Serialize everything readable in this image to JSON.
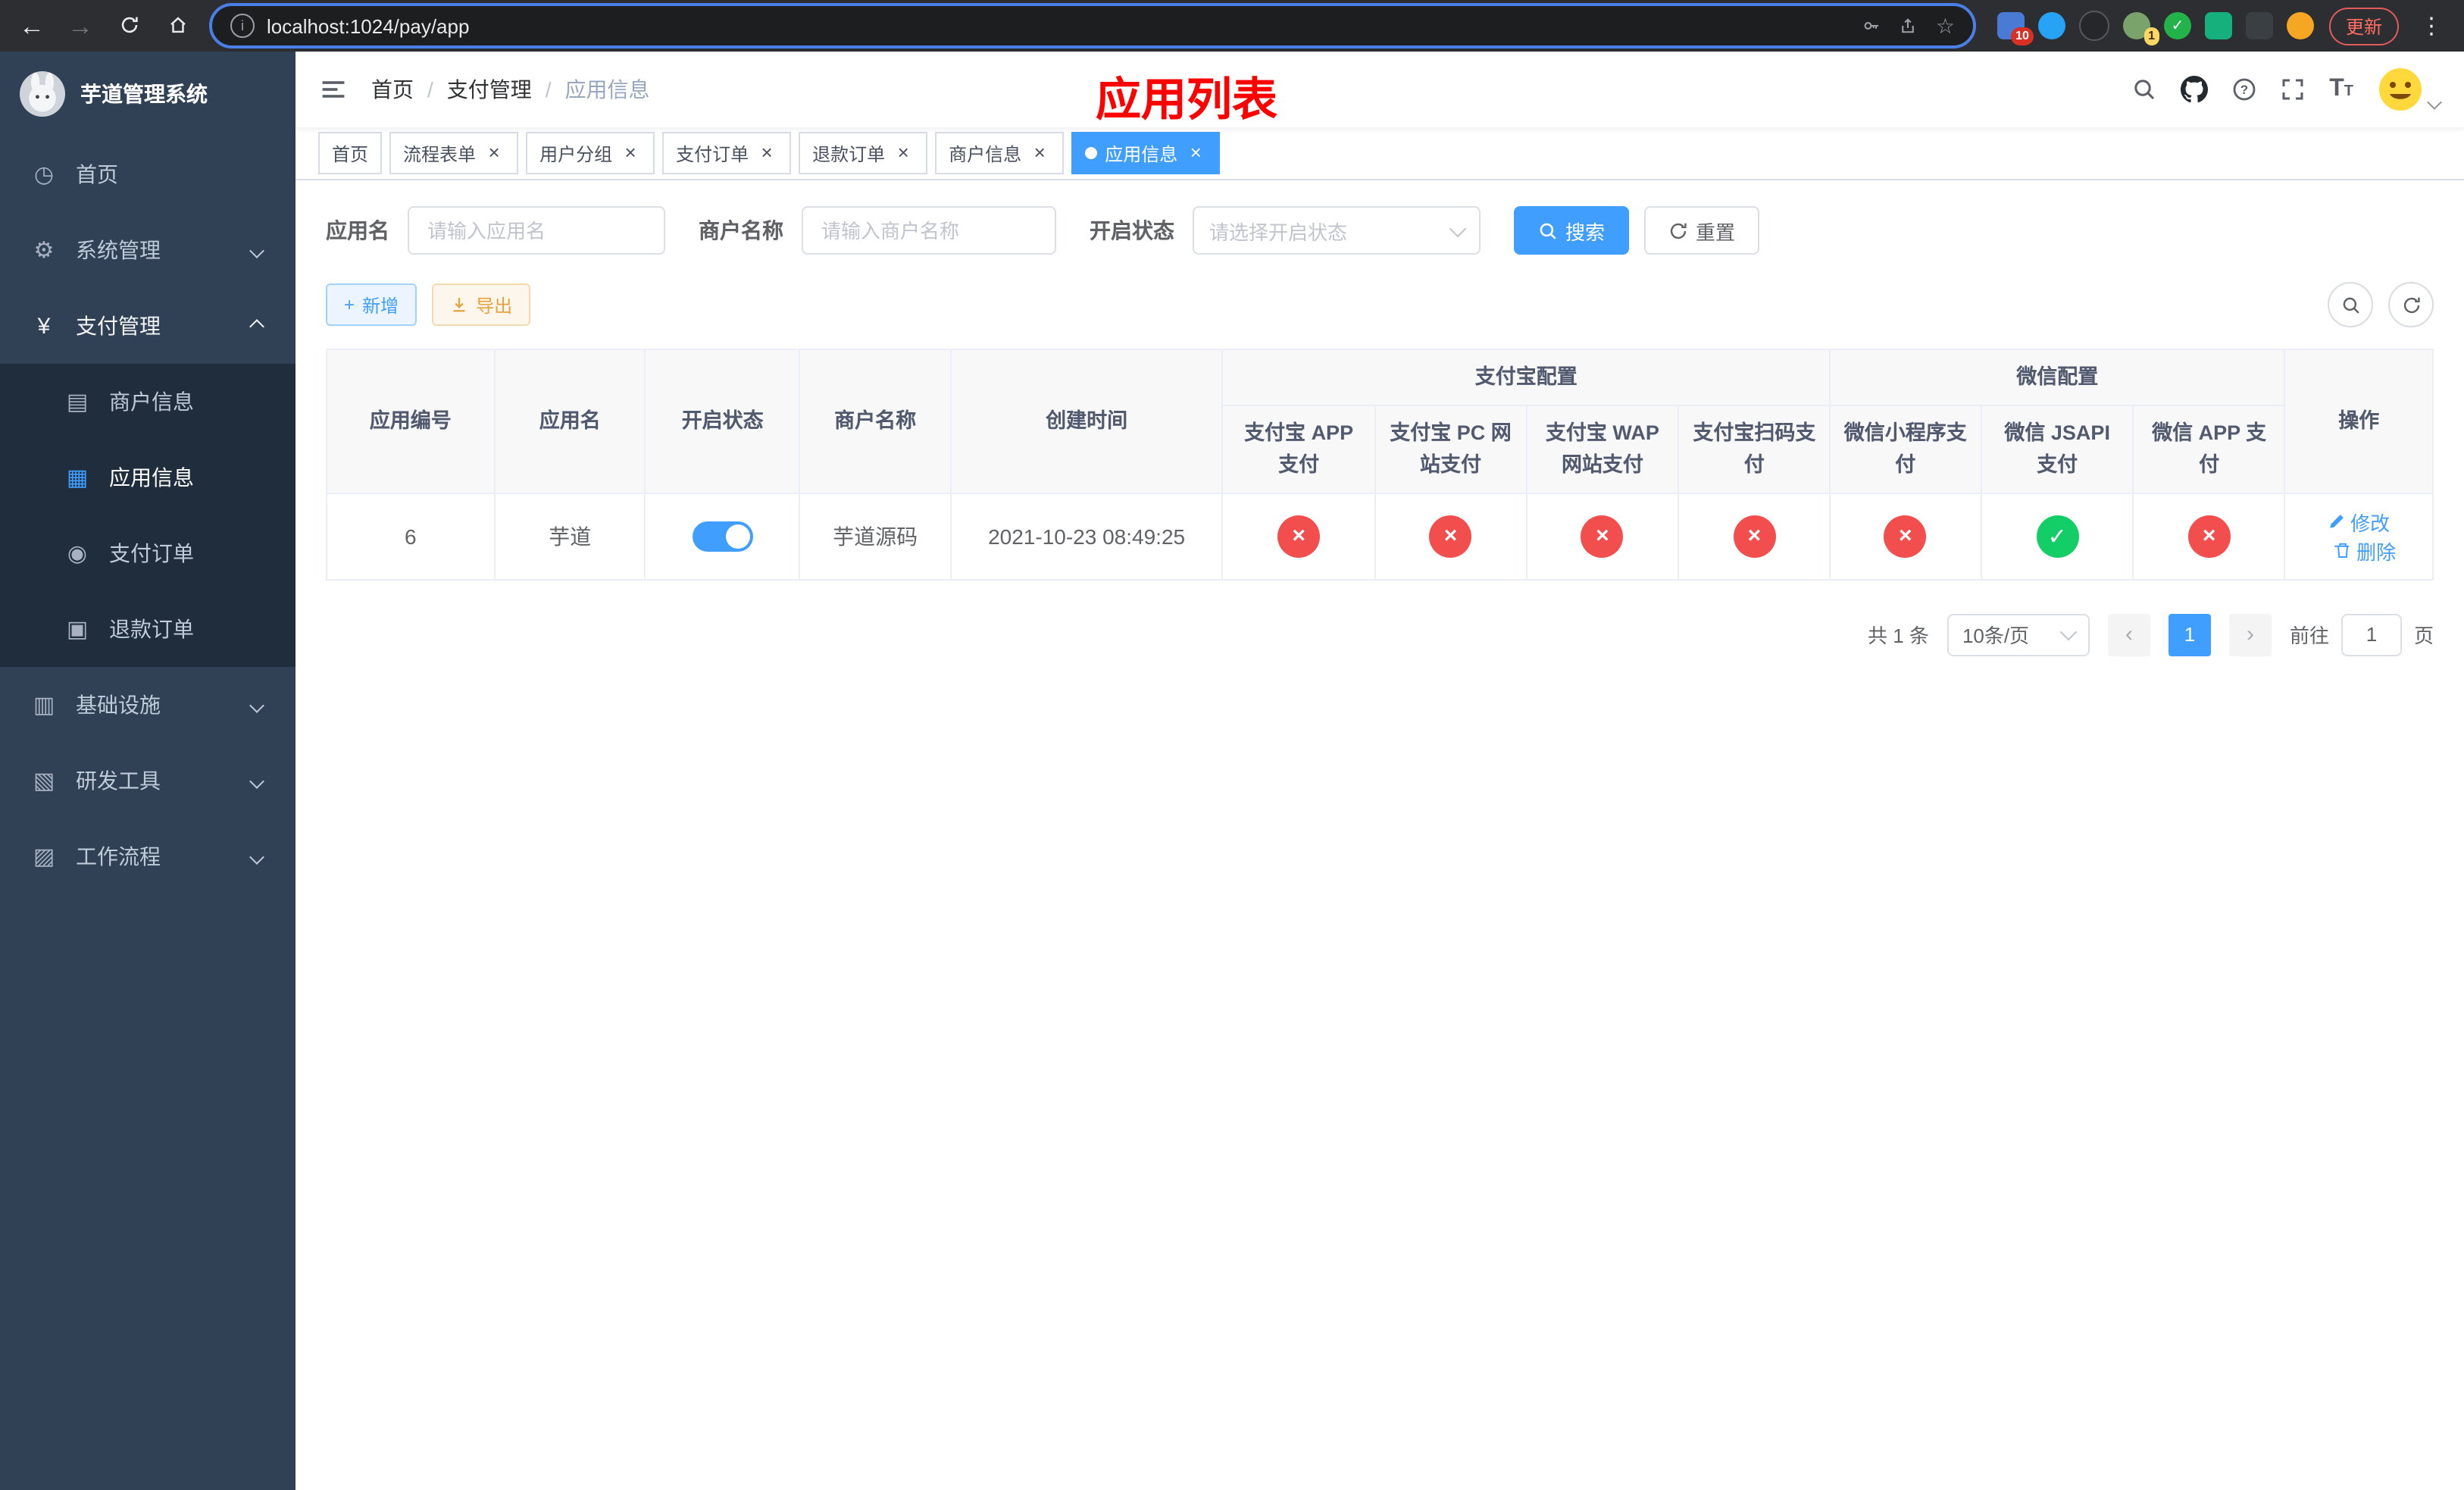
{
  "colors": {
    "accent": "#409eff",
    "danger": "#f24e4e",
    "success": "#13ce66",
    "warning": "#e6a23c",
    "sidebar_bg": "#304156",
    "submenu_bg": "#1f2d3d",
    "title_red": "#ff0000"
  },
  "browser": {
    "url": "localhost:1024/pay/app",
    "update_button": "更新",
    "extension_badge_puzzle": "10",
    "extension_badge_avatar": "1"
  },
  "sidebar": {
    "logo_title": "芋道管理系统",
    "items": [
      {
        "label": "首页",
        "icon": "dashboard"
      },
      {
        "label": "系统管理",
        "icon": "gear"
      },
      {
        "label": "支付管理",
        "icon": "yen"
      },
      {
        "label": "商户信息",
        "icon": "bank-card"
      },
      {
        "label": "应用信息",
        "icon": "grid"
      },
      {
        "label": "支付订单",
        "icon": "order"
      },
      {
        "label": "退款订单",
        "icon": "refund"
      },
      {
        "label": "基础设施",
        "icon": "infrastructure"
      },
      {
        "label": "研发工具",
        "icon": "tools"
      },
      {
        "label": "工作流程",
        "icon": "workflow"
      }
    ]
  },
  "navbar": {
    "breadcrumb": [
      "首页",
      "支付管理",
      "应用信息"
    ],
    "breadcrumb_separator": "/",
    "page_title": "应用列表"
  },
  "tabs": [
    {
      "label": "首页"
    },
    {
      "label": "流程表单"
    },
    {
      "label": "用户分组"
    },
    {
      "label": "支付订单"
    },
    {
      "label": "退款订单"
    },
    {
      "label": "商户信息"
    },
    {
      "label": "应用信息"
    }
  ],
  "filters": {
    "app_name_label": "应用名",
    "app_name_placeholder": "请输入应用名",
    "merchant_label": "商户名称",
    "merchant_placeholder": "请输入商户名称",
    "status_label": "开启状态",
    "status_placeholder": "请选择开启状态",
    "search_button": "搜索",
    "reset_button": "重置"
  },
  "toolbar": {
    "add_button": "新增",
    "export_button": "导出"
  },
  "table": {
    "headers": {
      "app_id": "应用编号",
      "app_name": "应用名",
      "status": "开启状态",
      "merchant": "商户名称",
      "created": "创建时间",
      "group_alipay": "支付宝配置",
      "group_wechat": "微信配置",
      "alipay_app": "支付宝 APP 支付",
      "alipay_pc": "支付宝 PC 网站支付",
      "alipay_wap": "支付宝 WAP 网站支付",
      "alipay_qr": "支付宝扫码支付",
      "wx_mini": "微信小程序支付",
      "wx_jsapi": "微信 JSAPI 支付",
      "wx_app": "微信 APP 支付",
      "action": "操作"
    },
    "row": {
      "id": "6",
      "name": "芋道",
      "enabled": true,
      "merchant": "芋道源码",
      "created": "2021-10-23 08:49:25",
      "statuses": [
        "no",
        "no",
        "no",
        "no",
        "no",
        "yes",
        "no"
      ],
      "edit_link": "修改",
      "delete_link": "删除"
    }
  },
  "pagination": {
    "total": "共 1 条",
    "page_size": "10条/页",
    "current_page": "1",
    "goto_label": "前往",
    "goto_value": "1",
    "page_unit": "页"
  }
}
